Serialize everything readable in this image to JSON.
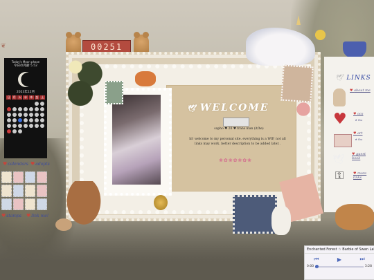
{
  "counter": {
    "value": "00251"
  },
  "moon": {
    "header": "Today's Moon phase",
    "title": "今日の月齢 5.52",
    "date": "2023年12月",
    "weekdays": [
      "日",
      "月",
      "火",
      "水",
      "木",
      "金",
      "土"
    ]
  },
  "left": {
    "calendars_label": "calendars",
    "adopts_label": "adopts",
    "stamps_label": "stamps",
    "linkme_label": "link me!"
  },
  "main": {
    "welcome": "WELCOME",
    "meta": "sapho ♥ 20 ♥ trans man (it/he)",
    "intro": "hi! welcome to my personal site. everything is a WIP, not all links may work. better description to be added later.."
  },
  "links": {
    "title": "LINKS",
    "items": [
      {
        "label": "about me"
      },
      {
        "label": "ocs",
        "sub": "★ tba"
      },
      {
        "label": "art",
        "sub": "★ tba"
      },
      {
        "label": "guest book"
      },
      {
        "label": "more links"
      }
    ]
  },
  "player": {
    "title": "Enchanted Forest ☆ Barbie of Swan Lake",
    "current_time": "0:00",
    "duration": "3:28",
    "progress": 0.02
  },
  "colors": {
    "accent_blue": "#2f44a2",
    "heart_red": "#c7373c",
    "counter_red": "#b34b3f"
  }
}
